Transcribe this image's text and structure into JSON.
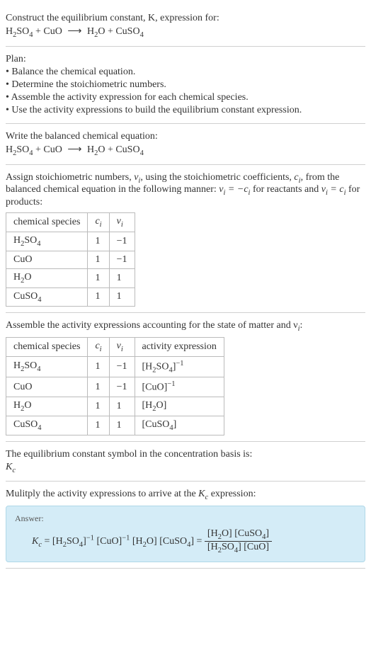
{
  "prompt": {
    "line1": "Construct the equilibrium constant, K, expression for:",
    "equation_lhs1": "H",
    "equation_lhs1_sub": "2",
    "equation_lhs2": "SO",
    "equation_lhs2_sub": "4",
    "plus1": " + CuO ",
    "arrow": "⟶",
    "rhs1": " H",
    "rhs1_sub": "2",
    "rhs2": "O + CuSO",
    "rhs2_sub": "4"
  },
  "plan": {
    "title": "Plan:",
    "b1": "• Balance the chemical equation.",
    "b2": "• Determine the stoichiometric numbers.",
    "b3": "• Assemble the activity expression for each chemical species.",
    "b4": "• Use the activity expressions to build the equilibrium constant expression."
  },
  "balanced": {
    "title": "Write the balanced chemical equation:"
  },
  "stoich": {
    "text1": "Assign stoichiometric numbers, ",
    "nu": "ν",
    "sub_i": "i",
    "text2": ", using the stoichiometric coefficients, ",
    "c": "c",
    "text3": ", from the balanced chemical equation in the following manner: ",
    "eq1": " = −",
    "text4": " for reactants and ",
    "eq2": " = ",
    "text5": " for products:",
    "headers": {
      "h1": "chemical species",
      "h2": "c",
      "h3": "ν"
    },
    "rows": [
      {
        "species": "H₂SO₄",
        "c": "1",
        "nu": "−1"
      },
      {
        "species": "CuO",
        "c": "1",
        "nu": "−1"
      },
      {
        "species": "H₂O",
        "c": "1",
        "nu": "1"
      },
      {
        "species": "CuSO₄",
        "c": "1",
        "nu": "1"
      }
    ]
  },
  "activity": {
    "title": "Assemble the activity expressions accounting for the state of matter and ν",
    "title_sub": "i",
    "title_end": ":",
    "headers": {
      "h1": "chemical species",
      "h2": "c",
      "h3": "ν",
      "h4": "activity expression"
    },
    "rows": [
      {
        "species": "H₂SO₄",
        "c": "1",
        "nu": "−1",
        "expr": "[H₂SO₄]⁻¹"
      },
      {
        "species": "CuO",
        "c": "1",
        "nu": "−1",
        "expr": "[CuO]⁻¹"
      },
      {
        "species": "H₂O",
        "c": "1",
        "nu": "1",
        "expr": "[H₂O]"
      },
      {
        "species": "CuSO₄",
        "c": "1",
        "nu": "1",
        "expr": "[CuSO₄]"
      }
    ]
  },
  "symbol": {
    "line1": "The equilibrium constant symbol in the concentration basis is:",
    "kc": "K",
    "kc_sub": "c"
  },
  "multiply": {
    "line1": "Mulitply the activity expressions to arrive at the ",
    "line2": " expression:"
  },
  "answer": {
    "label": "Answer:",
    "kc": "K",
    "kc_sub": "c",
    "eq": " = [H₂SO₄]⁻¹ [CuO]⁻¹ [H₂O] [CuSO₄] = ",
    "num": "[H₂O] [CuSO₄]",
    "den": "[H₂SO₄] [CuO]"
  }
}
